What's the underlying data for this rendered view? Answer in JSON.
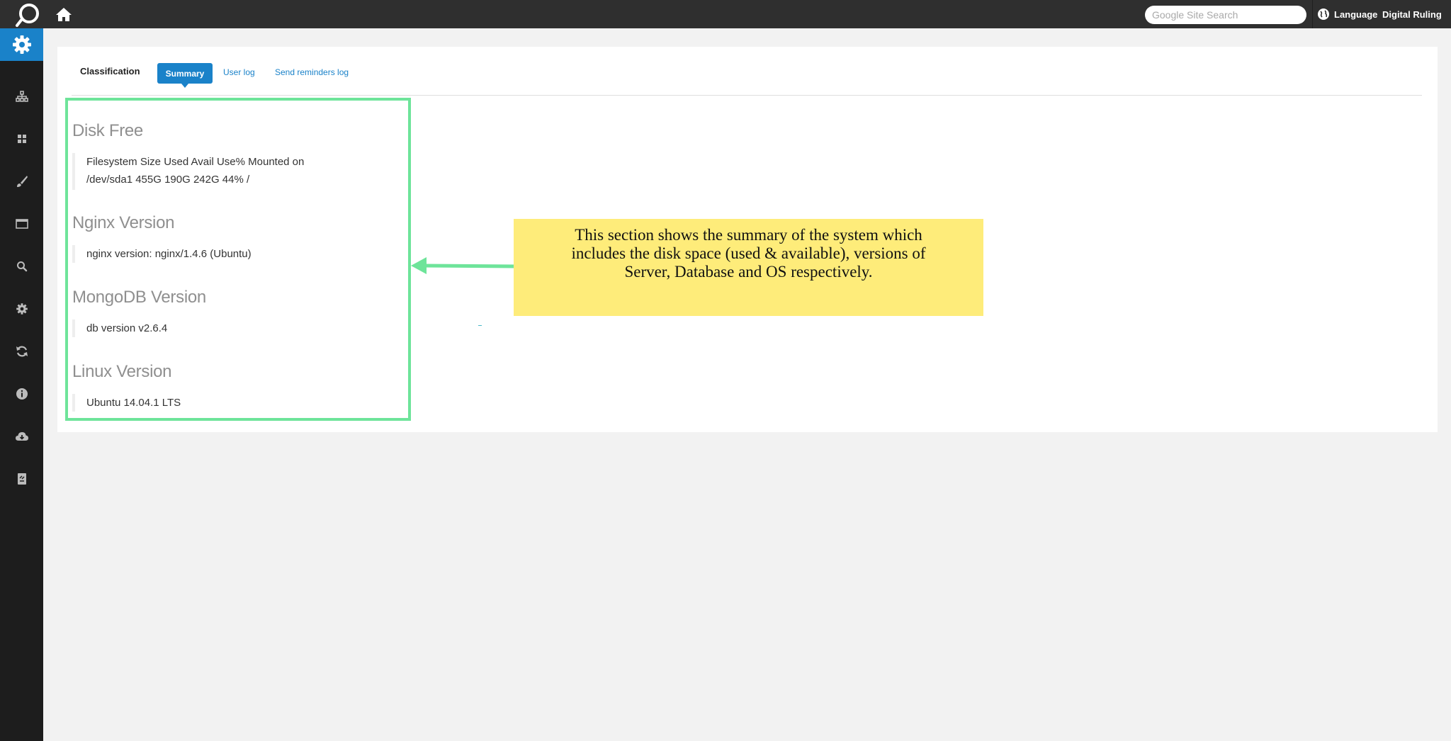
{
  "header": {
    "search_placeholder": "Google Site Search",
    "language_label": "Language",
    "user_label": "Digital Ruling",
    "colors": {
      "bar": "#2f2f2f",
      "accent": "#1a82c9"
    }
  },
  "sidebar": {
    "items": [
      {
        "icon": "gear-icon",
        "active": true
      },
      {
        "icon": "sitemap-icon"
      },
      {
        "icon": "grid-icon"
      },
      {
        "icon": "brush-icon"
      },
      {
        "icon": "window-icon"
      },
      {
        "icon": "search-icon"
      },
      {
        "icon": "settings-icon"
      },
      {
        "icon": "refresh-icon"
      },
      {
        "icon": "info-icon"
      },
      {
        "icon": "cloud-download-icon"
      },
      {
        "icon": "document-icon"
      }
    ]
  },
  "tabs": {
    "classification": "Classification",
    "summary": "Summary",
    "user_log": "User log",
    "send_reminders_log": "Send reminders log"
  },
  "summary": {
    "disk_free": {
      "title": "Disk Free",
      "line1": "Filesystem Size Used Avail Use% Mounted on",
      "line2": "/dev/sda1 455G 190G 242G 44% /"
    },
    "nginx": {
      "title": "Nginx Version",
      "value": "nginx version: nginx/1.4.6 (Ubuntu)"
    },
    "mongodb": {
      "title": "MongoDB Version",
      "value": "db version v2.6.4"
    },
    "linux": {
      "title": "Linux Version",
      "value": "Ubuntu 14.04.1 LTS"
    }
  },
  "annotation": {
    "line1": "This section shows the summary of the system which",
    "line2": "includes the disk space (used & available), versions of",
    "line3": "Server, Database and OS respectively.",
    "colors": {
      "box": "#feec7a",
      "highlight": "#6ee49a"
    }
  }
}
